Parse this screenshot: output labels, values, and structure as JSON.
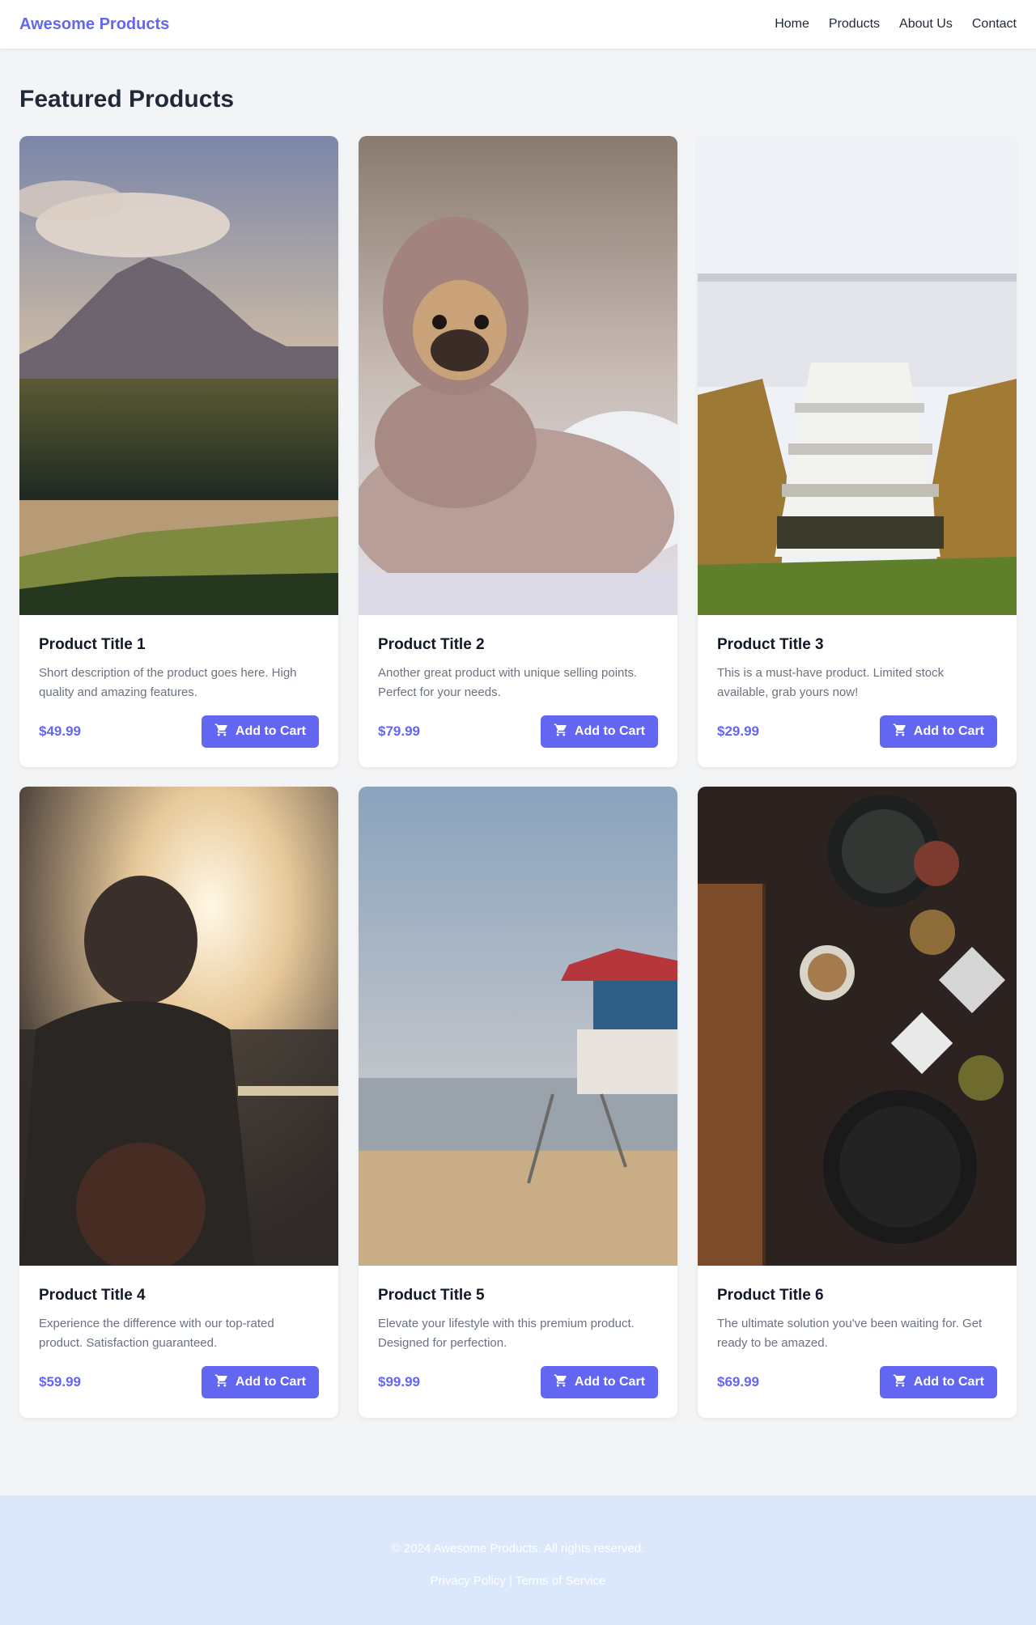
{
  "header": {
    "brand": "Awesome Products",
    "nav": [
      "Home",
      "Products",
      "About Us",
      "Contact"
    ]
  },
  "page_title": "Featured Products",
  "products": [
    {
      "title": "Product Title 1",
      "description": "Short description of the product goes here. High quality and amazing features.",
      "price": "$49.99",
      "button": "Add to Cart"
    },
    {
      "title": "Product Title 2",
      "description": "Another great product with unique selling points. Perfect for your needs.",
      "price": "$79.99",
      "button": "Add to Cart"
    },
    {
      "title": "Product Title 3",
      "description": "This is a must-have product. Limited stock available, grab yours now!",
      "price": "$29.99",
      "button": "Add to Cart"
    },
    {
      "title": "Product Title 4",
      "description": "Experience the difference with our top-rated product. Satisfaction guaranteed.",
      "price": "$59.99",
      "button": "Add to Cart"
    },
    {
      "title": "Product Title 5",
      "description": "Elevate your lifestyle with this premium product. Designed for perfection.",
      "price": "$99.99",
      "button": "Add to Cart"
    },
    {
      "title": "Product Title 6",
      "description": "The ultimate solution you've been waiting for. Get ready to be amazed.",
      "price": "$69.99",
      "button": "Add to Cart"
    }
  ],
  "footer": {
    "copyright": "© 2024 Awesome Products. All rights reserved.",
    "privacy": "Privacy Policy",
    "separator": " | ",
    "terms": "Terms of Service"
  },
  "colors": {
    "accent": "#6366f1",
    "background": "#f3f4f6",
    "footer_bg": "#dbe7fb"
  },
  "icons": {
    "cart": "shopping-cart-icon"
  }
}
